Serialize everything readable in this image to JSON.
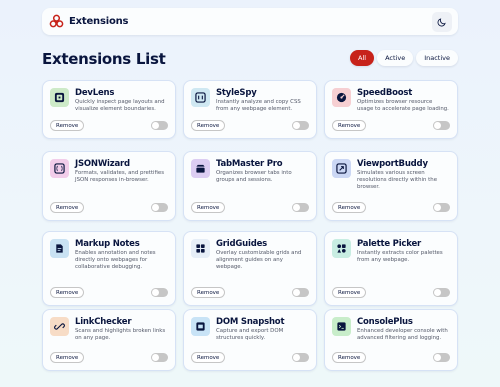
{
  "header": {
    "brand": "Extensions",
    "theme_icon": "moon-icon"
  },
  "main": {
    "title": "Extensions List",
    "filters": [
      {
        "label": "All",
        "active": true
      },
      {
        "label": "Active",
        "active": false
      },
      {
        "label": "Inactive",
        "active": false
      }
    ]
  },
  "colors": {
    "accent": "#c7221a",
    "toggle_off": "#c6c6c6",
    "card_border": "#d6e2f5"
  },
  "extensions": [
    {
      "name": "DevLens",
      "description": "Quickly inspect page layouts and visualize element boundaries.",
      "icon": "devlens-icon",
      "icon_bg": "#cdeac8",
      "remove_label": "Remove",
      "active": false
    },
    {
      "name": "StyleSpy",
      "description": "Instantly analyze and copy CSS from any webpage element.",
      "icon": "stylespy-icon",
      "icon_bg": "#cfe8f2",
      "remove_label": "Remove",
      "active": false
    },
    {
      "name": "SpeedBoost",
      "description": "Optimizes browser resource usage to accelerate page loading.",
      "icon": "speedboost-icon",
      "icon_bg": "#f6cfd2",
      "remove_label": "Remove",
      "active": false
    },
    {
      "name": "JSONWizard",
      "description": "Formats, validates, and prettifies JSON responses in-browser.",
      "icon": "jsonwizard-icon",
      "icon_bg": "#f2cdea",
      "remove_label": "Remove",
      "active": false
    },
    {
      "name": "TabMaster Pro",
      "description": "Organizes browser tabs into groups and sessions.",
      "icon": "tabmaster-icon",
      "icon_bg": "#dccdf2",
      "remove_label": "Remove",
      "active": false
    },
    {
      "name": "ViewportBuddy",
      "description": "Simulates various screen resolutions directly within the browser.",
      "icon": "viewport-icon",
      "icon_bg": "#cbd7f4",
      "remove_label": "Remove",
      "active": false
    },
    {
      "name": "Markup Notes",
      "description": "Enables annotation and notes directly onto webpages for collaborative debugging.",
      "icon": "markup-notes-icon",
      "icon_bg": "#c9e2f3",
      "remove_label": "Remove",
      "active": false
    },
    {
      "name": "GridGuides",
      "description": "Overlay customizable grids and alignment guides on any webpage.",
      "icon": "gridguides-icon",
      "icon_bg": "#e6eef7",
      "remove_label": "Remove",
      "active": false
    },
    {
      "name": "Palette Picker",
      "description": "Instantly extracts color palettes from any webpage.",
      "icon": "palette-icon",
      "icon_bg": "#c8ede2",
      "remove_label": "Remove",
      "active": false
    },
    {
      "name": "LinkChecker",
      "description": "Scans and highlights broken links on any page.",
      "icon": "linkchecker-icon",
      "icon_bg": "#f7dcc6",
      "remove_label": "Remove",
      "active": false
    },
    {
      "name": "DOM Snapshot",
      "description": "Capture and export DOM structures quickly.",
      "icon": "dom-snapshot-icon",
      "icon_bg": "#c8e3f6",
      "remove_label": "Remove",
      "active": false
    },
    {
      "name": "ConsolePlus",
      "description": "Enhanced developer console with advanced filtering and logging.",
      "icon": "consoleplus-icon",
      "icon_bg": "#c8edca",
      "remove_label": "Remove",
      "active": false
    }
  ]
}
